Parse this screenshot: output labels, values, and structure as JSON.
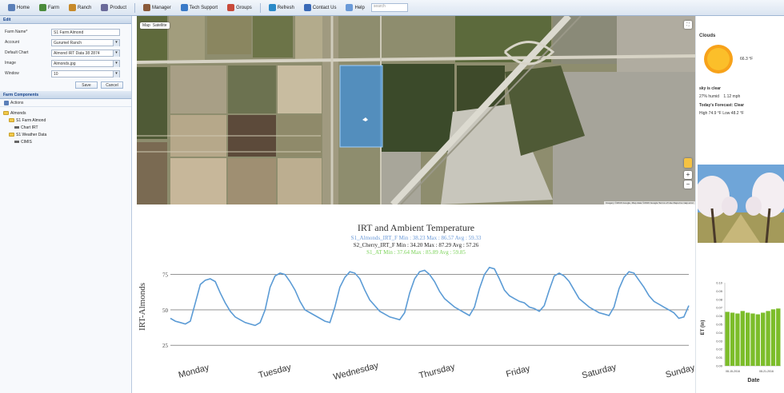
{
  "toolbar": {
    "items": [
      {
        "label": "Home",
        "icon": "home-icon",
        "color": "#5a7fb8"
      },
      {
        "label": "Farm",
        "icon": "farm-icon",
        "color": "#4a8b3b"
      },
      {
        "label": "Ranch",
        "icon": "ranch-icon",
        "color": "#c78a2a"
      },
      {
        "label": "Product",
        "icon": "product-icon",
        "color": "#6a6a9a"
      },
      {
        "label": "Manager",
        "icon": "manager-icon",
        "color": "#8a5a3a"
      },
      {
        "label": "Tech Support",
        "icon": "support-icon",
        "color": "#3a7ac8"
      },
      {
        "label": "Groups",
        "icon": "groups-icon",
        "color": "#c84a3a"
      },
      {
        "label": "Refresh",
        "icon": "refresh-icon",
        "color": "#2a8ac8"
      },
      {
        "label": "Contact Us",
        "icon": "contact-icon",
        "color": "#3a6ab8"
      },
      {
        "label": "Help",
        "icon": "help-icon",
        "color": "#6a9ad8"
      }
    ],
    "search_placeholder": "search"
  },
  "left": {
    "edit_title": "Edit",
    "form": [
      {
        "label": "Farm Name*",
        "value": "S1 Farm Almond",
        "has_drop": false
      },
      {
        "label": "Account",
        "value": "Gurumel Ranch",
        "has_drop": true
      },
      {
        "label": "Default Chart",
        "value": "Almond IRT Data 38 2874",
        "has_drop": true
      },
      {
        "label": "Image",
        "value": "Almonds.jpg",
        "has_drop": true
      },
      {
        "label": "Window",
        "value": "10",
        "has_drop": true
      }
    ],
    "save_label": "Save",
    "cancel_label": "Cancel",
    "components_title": "Farm Components",
    "actions_label": "Actions",
    "tree": [
      {
        "label": "Almonds",
        "level": 0,
        "kind": "folder"
      },
      {
        "label": "S1 Farm Almond",
        "level": 1,
        "kind": "folder"
      },
      {
        "label": "Chart IRT",
        "level": 2,
        "kind": "leaf"
      },
      {
        "label": "S1 Weather Data",
        "level": 1,
        "kind": "folder"
      },
      {
        "label": "CIMIS",
        "level": 2,
        "kind": "leaf"
      }
    ]
  },
  "map": {
    "type_buttons": [
      "Map",
      "Satellite"
    ],
    "attribution": "Imagery ©2016 Google, Map data ©2016 Google  Terms of Use  Report a map error"
  },
  "chart_data": {
    "type": "line",
    "title": "IRT and Ambient Temperature",
    "subtitle_lines": [
      {
        "text": "S1_Almonds_IRT_F Min : 38.23 Max : 86.57 Avg : 59.33",
        "color": "#6b9ad8"
      },
      {
        "text": "S2_Cherry_IRT_F Min : 34.20 Max : 87.29 Avg : 57.26",
        "color": "#222222"
      },
      {
        "text": "S1_AT Min : 37.64 Max : 85.89 Avg : 59.85",
        "color": "#7cd35a"
      }
    ],
    "ylabel": "IRT-Almonds",
    "y_ticks": [
      75,
      50,
      25
    ],
    "ylim": [
      20,
      85
    ],
    "categories": [
      "Monday",
      "Tuesday",
      "Wednesday",
      "Thursday",
      "Friday",
      "Saturday",
      "Sunday"
    ],
    "series": [
      {
        "name": "S1_Almonds_IRT_F",
        "color": "#5b9bd5",
        "values": [
          44,
          42,
          41,
          40,
          42,
          55,
          68,
          71,
          72,
          70,
          62,
          55,
          49,
          45,
          43,
          41,
          40,
          39,
          41,
          50,
          66,
          74,
          76,
          75,
          70,
          64,
          56,
          50,
          48,
          46,
          44,
          42,
          41,
          52,
          66,
          73,
          77,
          76,
          72,
          64,
          57,
          53,
          49,
          47,
          45,
          44,
          43,
          48,
          62,
          72,
          77,
          78,
          75,
          70,
          63,
          58,
          55,
          52,
          50,
          48,
          46,
          52,
          65,
          75,
          80,
          79,
          72,
          64,
          60,
          58,
          56,
          55,
          52,
          51,
          49,
          53,
          64,
          74,
          76,
          74,
          70,
          64,
          58,
          55,
          52,
          50,
          48,
          47,
          46,
          52,
          65,
          73,
          77,
          76,
          71,
          66,
          60,
          56,
          54,
          52,
          50,
          48,
          44,
          45,
          53
        ]
      }
    ]
  },
  "weather": {
    "condition": "Clouds",
    "temp": "66.3 °F",
    "sky": "sky is clear",
    "humidity": "27% humid",
    "wind": "1.12 mph",
    "forecast_label": "Today's Forecast: Clear",
    "high_low": "High 74.9 °F  Low 48.2 °F"
  },
  "et_chart": {
    "ylabel": "ET (in)",
    "y_ticks": [
      "0.10",
      "0.09",
      "0.08",
      "0.07",
      "0.06",
      "0.05",
      "0.04",
      "0.03",
      "0.02",
      "0.01",
      "0.00"
    ],
    "values": [
      0.065,
      0.064,
      0.063,
      0.066,
      0.064,
      0.063,
      0.062,
      0.064,
      0.066,
      0.068,
      0.069
    ],
    "x_labels": [
      "08-15-2016",
      "08-21-2016"
    ],
    "xlabel": "Date",
    "bar_color": "#7cbd2a"
  }
}
